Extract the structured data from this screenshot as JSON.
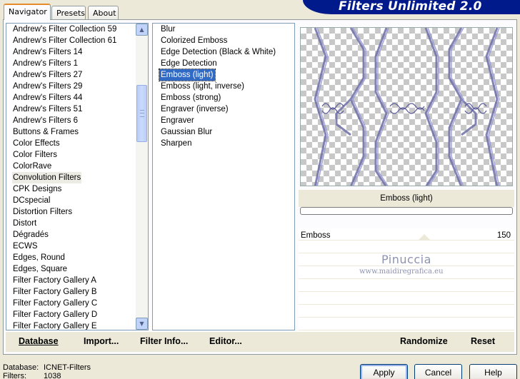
{
  "tabs": [
    {
      "label": "Navigator",
      "active": true
    },
    {
      "label": "Presets",
      "active": false
    },
    {
      "label": "About",
      "active": false
    }
  ],
  "banner": {
    "title": "Filters Unlimited 2.0",
    "color": "#001a8c"
  },
  "categories": {
    "items": [
      "Andrew's Filter Collection 59",
      "Andrew's Filter Collection 61",
      "Andrew's Filters 14",
      "Andrew's Filters 1",
      "Andrew's Filters 27",
      "Andrew's Filters 29",
      "Andrew's Filters 44",
      "Andrew's Filters 51",
      "Andrew's Filters 6",
      "Buttons & Frames",
      "Color Effects",
      "Color Filters",
      "ColorRave",
      "Convolution Filters",
      "CPK Designs",
      "DCspecial",
      "Distortion Filters",
      "Distort",
      "Dégradés",
      "ECWS",
      "Edges, Round",
      "Edges, Square",
      "Filter Factory Gallery A",
      "Filter Factory Gallery B",
      "Filter Factory Gallery C",
      "Filter Factory Gallery D",
      "Filter Factory Gallery E"
    ],
    "selected": "Convolution Filters"
  },
  "filters": {
    "items": [
      "Blur",
      "Colorized Emboss",
      "Edge Detection (Black & White)",
      "Edge Detection",
      "Emboss (light)",
      "Emboss (light, inverse)",
      "Emboss (strong)",
      "Engraver (inverse)",
      "Engraver",
      "Gaussian Blur",
      "Sharpen"
    ],
    "selected": "Emboss (light)",
    "selection_color": "#316ac5"
  },
  "filter_name": "Emboss (light)",
  "slider": {
    "label": "Emboss",
    "value": "150"
  },
  "watermark": {
    "title": "Pinuccia",
    "url": "www.maidiregrafica.eu"
  },
  "bottom_buttons": {
    "database": "Database",
    "import": "Import...",
    "filter_info": "Filter Info...",
    "editor": "Editor...",
    "randomize": "Randomize",
    "reset": "Reset"
  },
  "footer": {
    "database_label": "Database:",
    "database_value": "ICNET-Filters",
    "filters_label": "Filters:",
    "filters_value": "1038"
  },
  "dialog_buttons": {
    "apply": "Apply",
    "cancel": "Cancel",
    "help": "Help"
  },
  "icons": {
    "scroll_up": "chevron-up-icon",
    "scroll_down": "chevron-down-icon"
  }
}
